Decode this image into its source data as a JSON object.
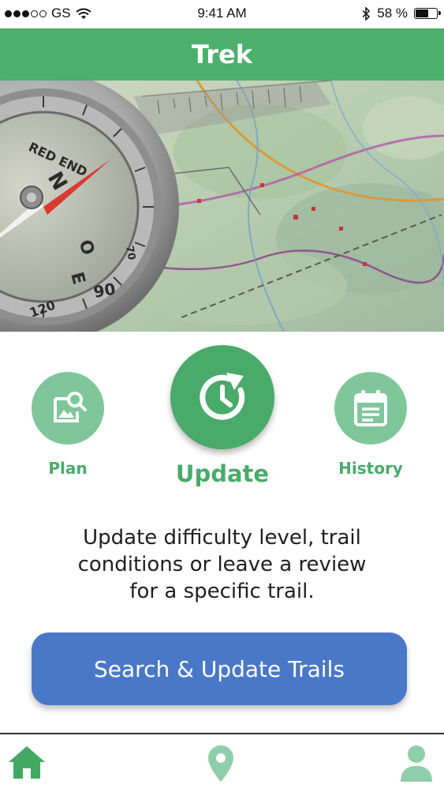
{
  "status_bar": {
    "carrier": "GS",
    "time": "9:41 AM",
    "battery_percent": "58 %",
    "signal_bars_filled": 3,
    "signal_bars_total": 5,
    "battery_level": 0.58
  },
  "header": {
    "title": "Trek"
  },
  "hero": {
    "image": "compass-on-map-photo"
  },
  "features": [
    {
      "label": "Plan",
      "icon": "image-search-icon"
    },
    {
      "label": "Update",
      "icon": "update-clock-icon"
    },
    {
      "label": "History",
      "icon": "calendar-list-icon"
    }
  ],
  "description": {
    "line1": "Update difficulty level, trail",
    "line2": "conditions or leave a review",
    "line3": "for a specific trail."
  },
  "cta_button": {
    "label": "Search & Update Trails"
  },
  "tab_bar": {
    "tabs": [
      {
        "icon": "home-icon",
        "active": true
      },
      {
        "icon": "map-pin-icon",
        "active": false
      },
      {
        "icon": "profile-icon",
        "active": false
      }
    ]
  },
  "colors": {
    "primary_green": "#4caf6b",
    "light_green": "#7fc79a",
    "button_blue": "#4a78c8"
  }
}
